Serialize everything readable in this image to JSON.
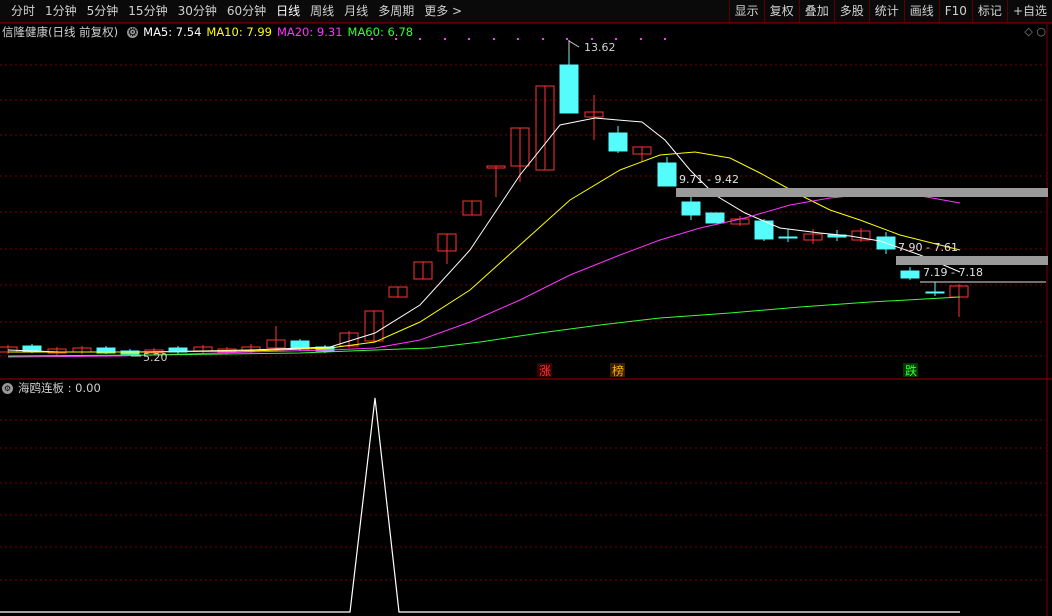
{
  "toolbar": {
    "tabs": [
      "分时",
      "1分钟",
      "5分钟",
      "15分钟",
      "30分钟",
      "60分钟",
      "日线",
      "周线",
      "月线",
      "多周期",
      "更多"
    ],
    "active": "日线",
    "right_buttons": [
      "显示",
      "复权",
      "叠加",
      "多股",
      "统计",
      "画线",
      "F10",
      "标记",
      "+自选"
    ]
  },
  "main": {
    "title": "信隆健康(日线 前复权)",
    "ma": [
      {
        "label": "MA5: 7.54",
        "color": "#ffffff"
      },
      {
        "label": "MA10: 7.99",
        "color": "#ffff00"
      },
      {
        "label": "MA20: 9.31",
        "color": "#ff33ff"
      },
      {
        "label": "MA60: 6.78",
        "color": "#33ff33"
      }
    ],
    "annotations": {
      "high": "13.62",
      "low": "5.20",
      "range1": "9.71 - 9.42",
      "range2": "7.90 - 7.61",
      "range3": "7.19 - 7.18"
    },
    "markers": [
      {
        "text": "涨",
        "color": "#ff3333"
      },
      {
        "text": "榜",
        "color": "#ffaa00"
      },
      {
        "text": "跌",
        "color": "#33ff33"
      }
    ]
  },
  "sub": {
    "title": "海鸥连板 : 0.00"
  },
  "colors": {
    "up": "#ff3333",
    "down": "#54fcfc",
    "grid": "#7a0000",
    "separator": "#a00000"
  }
}
